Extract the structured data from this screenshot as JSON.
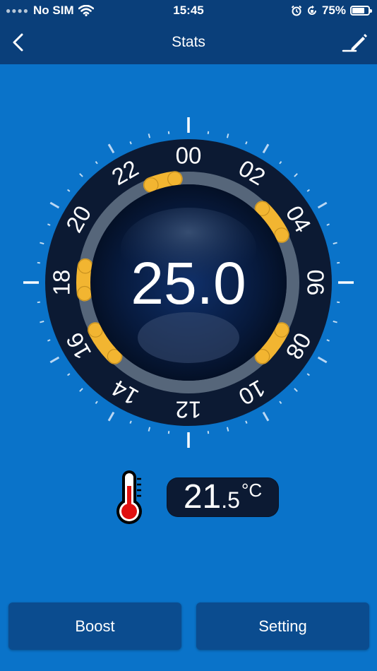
{
  "status_bar": {
    "carrier": "No SIM",
    "time": "15:45",
    "battery_percent": "75%",
    "battery_level": 0.75,
    "icons": [
      "signal-dots-icon",
      "wifi-icon",
      "alarm-icon",
      "rotation-lock-icon",
      "battery-icon"
    ]
  },
  "nav": {
    "title": "Stats",
    "back_icon": "chevron-left-icon",
    "edit_icon": "pencil-icon"
  },
  "dial": {
    "setpoint": "25.0",
    "hour_labels": [
      "00",
      "02",
      "04",
      "06",
      "08",
      "10",
      "12",
      "14",
      "16",
      "18",
      "20",
      "22"
    ],
    "heating_periods": [
      {
        "start": 22.6,
        "end": 23.5
      },
      {
        "start": 3.0,
        "end": 4.2
      },
      {
        "start": 7.8,
        "end": 9.0
      },
      {
        "start": 15.0,
        "end": 16.2
      },
      {
        "start": 17.6,
        "end": 18.6
      }
    ],
    "colors": {
      "bezel": "#0c1a33",
      "track": "#56667a",
      "period": "#f2b531",
      "face": "#061430"
    }
  },
  "room_temperature": {
    "integer": "21",
    "decimal": ".5",
    "unit": "°C",
    "icon": "thermometer-icon"
  },
  "buttons": {
    "boost": "Boost",
    "setting": "Setting"
  },
  "colors": {
    "background": "#0a73c9",
    "header": "#0a3f7a",
    "button": "#0b4c8f"
  }
}
